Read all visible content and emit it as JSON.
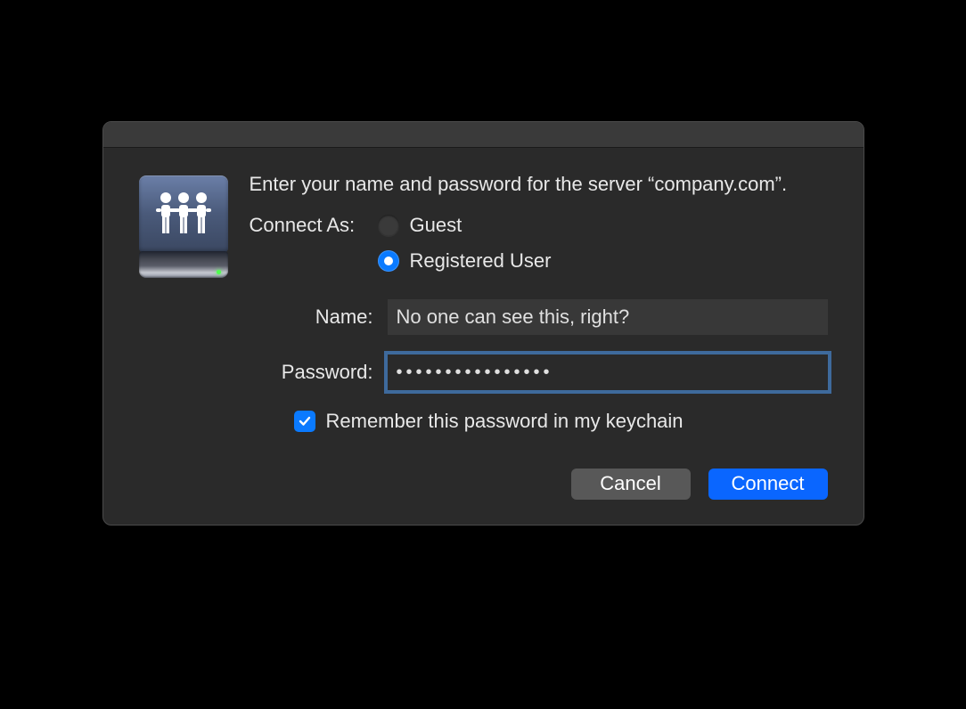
{
  "dialog": {
    "prompt": "Enter your name and password for the server “company.com”.",
    "connect_as_label": "Connect As:",
    "radio_guest": "Guest",
    "radio_registered": "Registered User",
    "selected_mode": "registered",
    "name_label": "Name:",
    "name_value": "No one can see this, right?",
    "password_label": "Password:",
    "password_value": "••••••••••••••••",
    "remember_label": "Remember this password in my keychain",
    "remember_checked": true,
    "cancel_button": "Cancel",
    "connect_button": "Connect"
  },
  "colors": {
    "accent": "#0a7aff"
  }
}
